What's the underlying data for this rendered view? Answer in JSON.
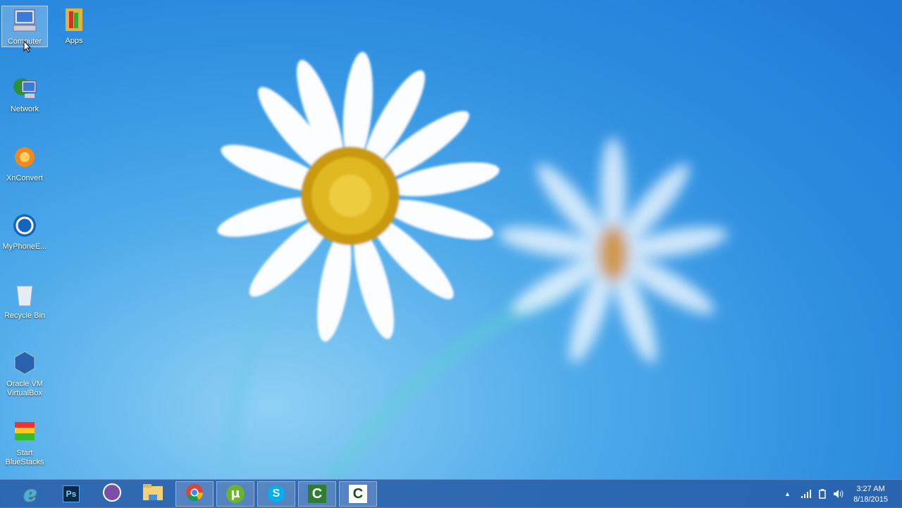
{
  "desktop": {
    "icons": [
      {
        "label": "Computer",
        "icon": "computer-icon",
        "selected": true
      },
      {
        "label": "Apps",
        "icon": "folder-icon"
      },
      {
        "label": "Network",
        "icon": "network-icon"
      },
      {
        "label": "XnConvert",
        "icon": "xnconvert-icon"
      },
      {
        "label": "MyPhoneE...",
        "icon": "myphoneexplorer-icon"
      },
      {
        "label": "Recycle Bin",
        "icon": "recycle-bin-icon"
      },
      {
        "label": "Oracle VM VirtualBox",
        "icon": "virtualbox-icon"
      },
      {
        "label": "Start BlueStacks",
        "icon": "bluestacks-icon"
      }
    ]
  },
  "taskbar": {
    "apps": [
      {
        "name": "Internet Explorer",
        "icon": "ie-icon"
      },
      {
        "name": "Photoshop",
        "icon": "photoshop-icon",
        "text": "Ps"
      },
      {
        "name": "Viber",
        "icon": "viber-icon"
      },
      {
        "name": "File Explorer",
        "icon": "file-explorer-icon"
      },
      {
        "name": "Chrome",
        "icon": "chrome-icon",
        "running": true
      },
      {
        "name": "uTorrent",
        "icon": "utorrent-icon",
        "running": true
      },
      {
        "name": "Skype",
        "icon": "skype-icon",
        "text": "S",
        "running": true
      },
      {
        "name": "Camtasia",
        "icon": "camtasia-icon",
        "running": true
      },
      {
        "name": "Camtasia Recorder",
        "icon": "camtasia-recorder-icon",
        "running": true
      }
    ],
    "clock": {
      "time": "3:27 AM",
      "date": "8/18/2015"
    }
  }
}
